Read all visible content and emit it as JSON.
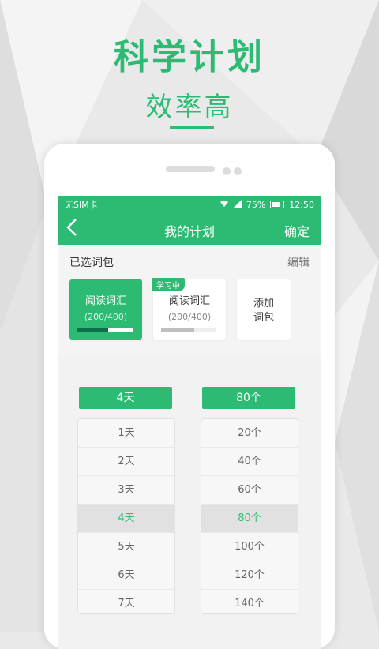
{
  "promo": {
    "title": "科学计划",
    "subtitle": "效率高"
  },
  "status_bar": {
    "carrier": "无SIM卡",
    "battery": "75%",
    "time": "12:50"
  },
  "toolbar": {
    "title": "我的计划",
    "confirm_label": "确定"
  },
  "packages": {
    "section_label": "已选词包",
    "edit_label": "编辑",
    "cards": [
      {
        "name": "阅读词汇",
        "count": "(200/400)",
        "progress": 0.55
      },
      {
        "name": "阅读词汇",
        "count": "(200/400)",
        "progress": 0.6,
        "badge": "学习中"
      }
    ],
    "add_label_1": "添加",
    "add_label_2": "词包"
  },
  "days_picker": {
    "selected_display": "4天",
    "options": [
      "1天",
      "2天",
      "3天",
      "4天",
      "5天",
      "6天",
      "7天"
    ],
    "selected_index": 3
  },
  "words_picker": {
    "selected_display": "80个",
    "options": [
      "20个",
      "40个",
      "60个",
      "80个",
      "100个",
      "120个",
      "140个"
    ],
    "selected_index": 3
  },
  "colors": {
    "accent": "#2dbb74",
    "progress_dark": "#0f6e4a"
  }
}
